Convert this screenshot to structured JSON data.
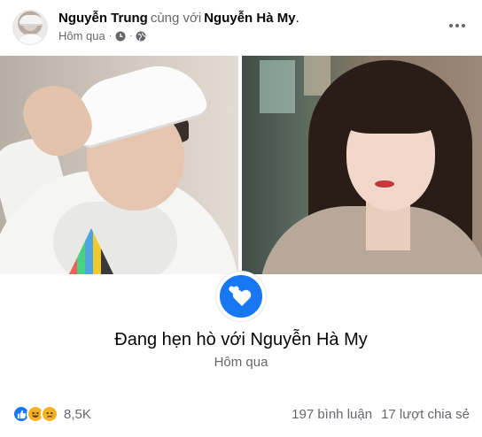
{
  "post": {
    "author": "Nguyễn Trung",
    "with_text": "cùng với",
    "partner": "Nguyễn Hà My",
    "period": ".",
    "time": "Hôm qua",
    "meta_separator": "·"
  },
  "event": {
    "title": "Đang hẹn hò với Nguyễn Hà My",
    "date": "Hôm qua"
  },
  "footer": {
    "reaction_count": "8,5K",
    "comments": "197 bình luận",
    "shares": "17 lượt chia sẻ"
  },
  "icons": {
    "privacy": "globe-icon",
    "time": "clock-icon",
    "badge": "hearts-icon",
    "menu": "more-icon",
    "reactions": [
      "like-icon",
      "haha-icon",
      "sad-icon"
    ]
  },
  "colors": {
    "accent": "#1877f2",
    "secondary_text": "#65676b",
    "reaction_yellow": "#f7b125"
  }
}
